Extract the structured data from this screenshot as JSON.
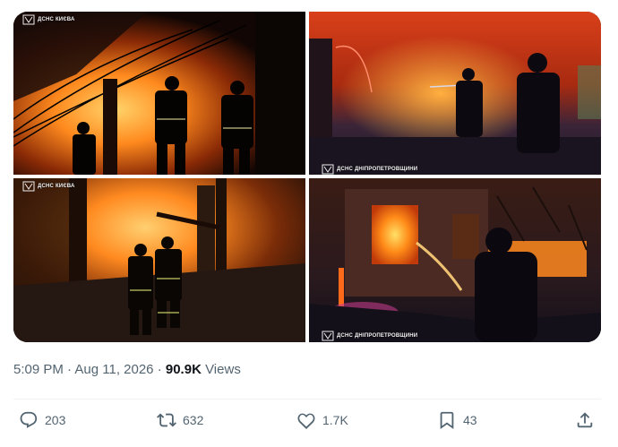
{
  "tweet": {
    "photos": [
      {
        "watermark": "ДСНС КИЄВА"
      },
      {
        "watermark": "ДСНС ДНІПРОПЕТРОВЩИНИ"
      },
      {
        "watermark": "ДСНС КИЄВА"
      },
      {
        "watermark": "ДСНС ДНІПРОПЕТРОВЩИНИ"
      }
    ],
    "meta": {
      "time": "5:09 PM",
      "sep1": "·",
      "date": "Aug 11, 2026",
      "sep2": "·",
      "views_count": "90.9K",
      "views_label": "Views"
    },
    "actions": {
      "replies": "203",
      "reposts": "632",
      "likes": "1.7K",
      "bookmarks": "43"
    }
  },
  "icons": [
    "reply-icon",
    "repost-icon",
    "like-icon",
    "bookmark-icon",
    "share-icon"
  ],
  "colors": {
    "text_secondary": "#536471",
    "text_primary": "#0f1419",
    "divider": "#eff3f4"
  }
}
